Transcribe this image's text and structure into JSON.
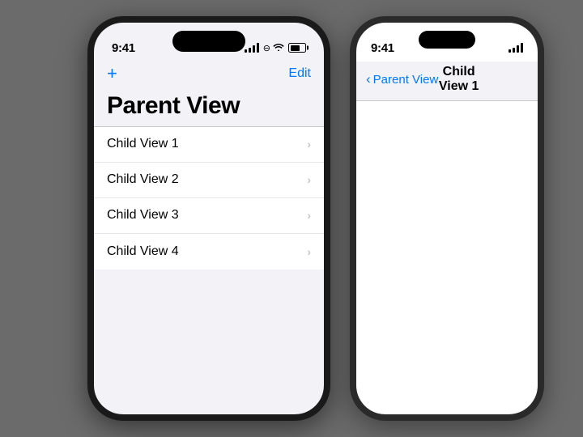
{
  "phone_left": {
    "status": {
      "time": "9:41",
      "signal_label": "signal",
      "wifi_label": "wifi",
      "battery_label": "battery"
    },
    "nav": {
      "add_label": "+",
      "edit_label": "Edit"
    },
    "title": "Parent View",
    "list_items": [
      {
        "label": "Child View 1"
      },
      {
        "label": "Child View 2"
      },
      {
        "label": "Child View 3"
      },
      {
        "label": "Child View 4"
      }
    ]
  },
  "phone_right": {
    "status": {
      "time": "9:41"
    },
    "nav": {
      "back_label": "Parent View",
      "title": "Child View 1"
    }
  }
}
